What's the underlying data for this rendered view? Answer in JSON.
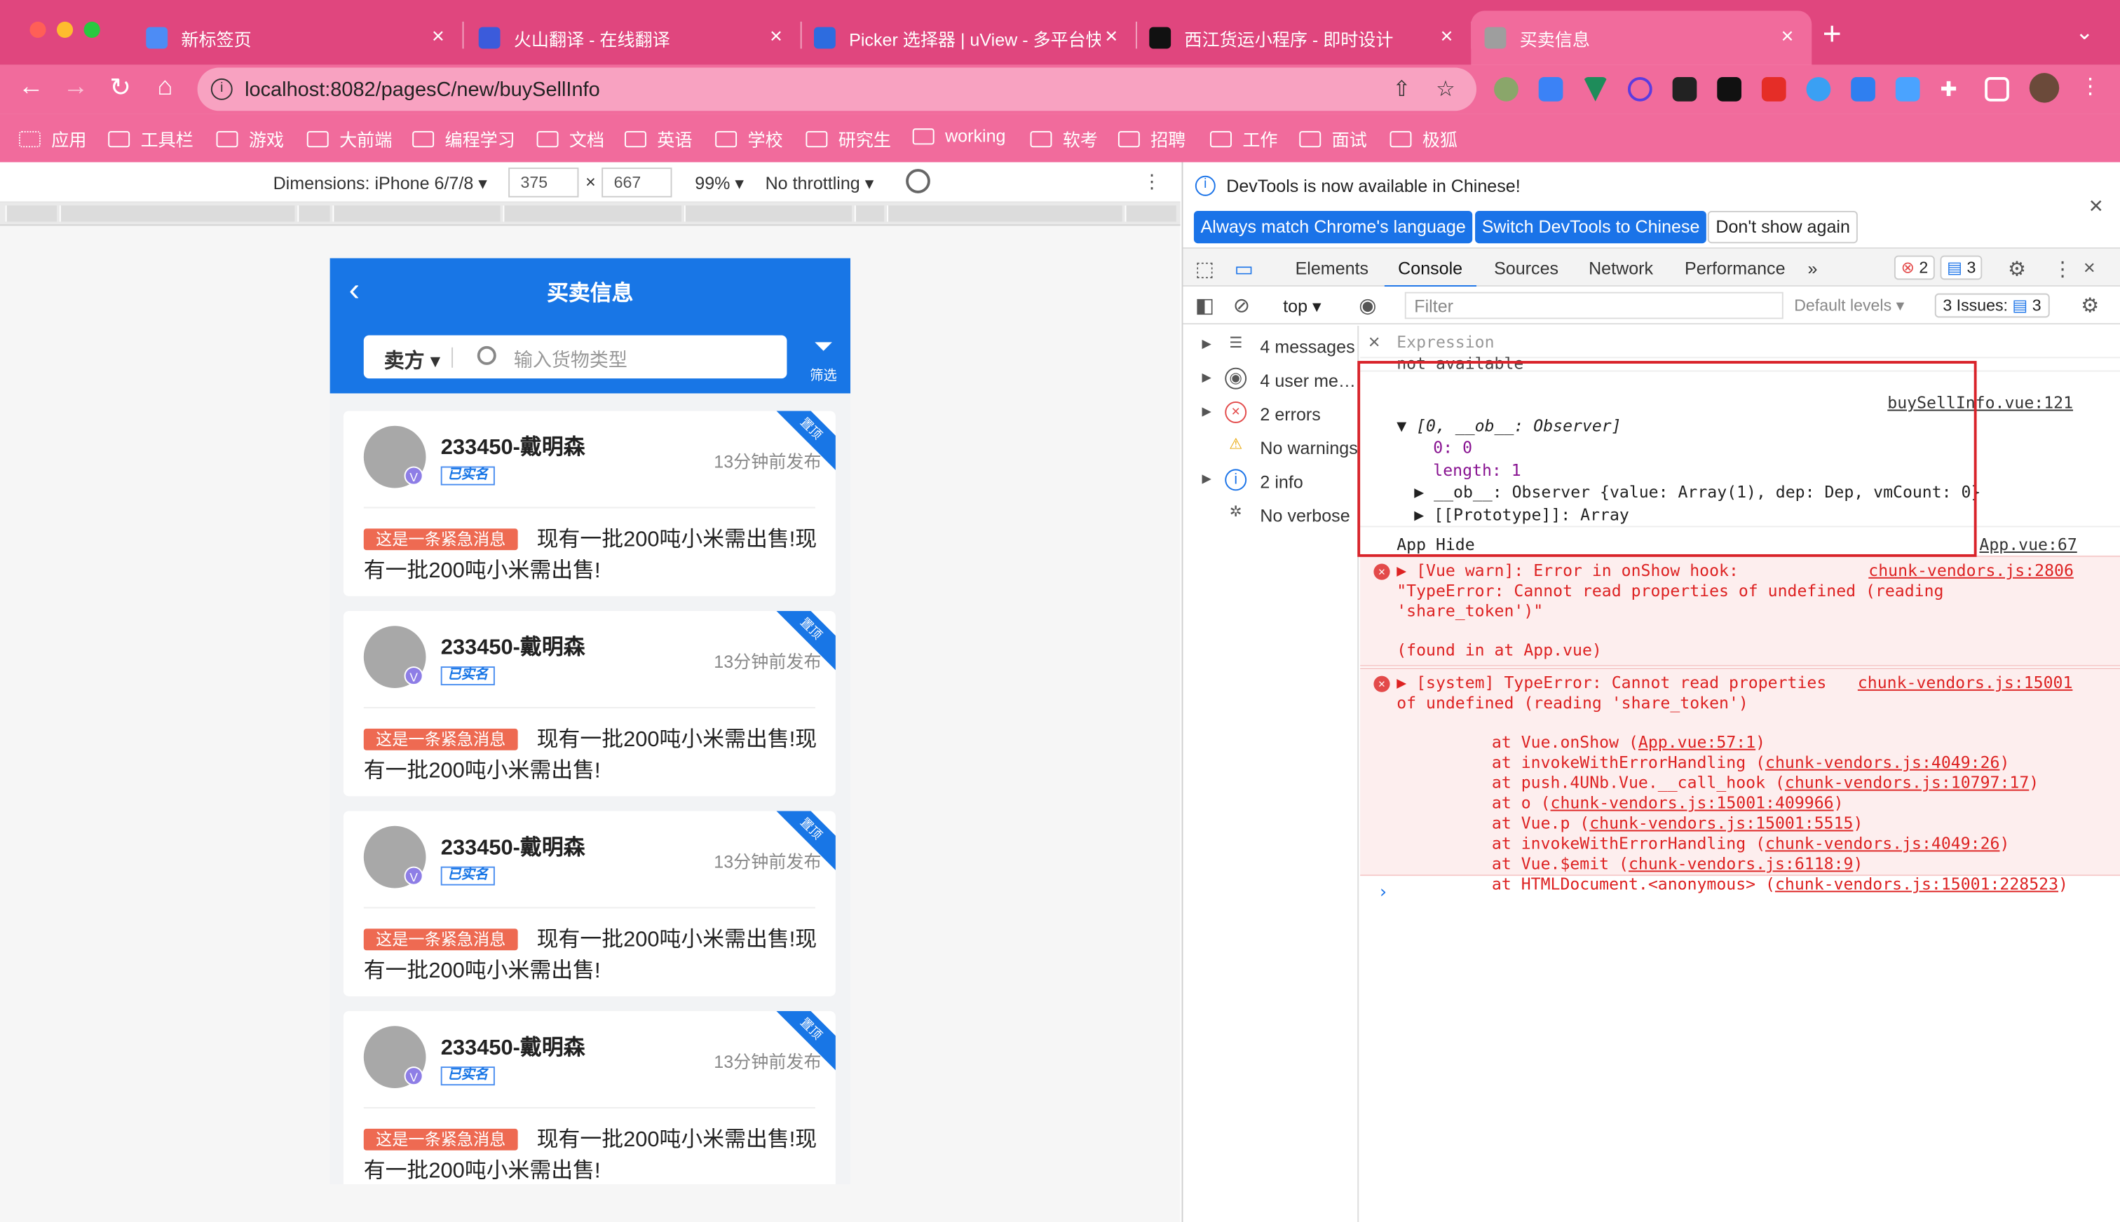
{
  "browser": {
    "tabs": [
      {
        "title": "新标签页",
        "favicon_color": "#4d8cf5"
      },
      {
        "title": "火山翻译 - 在线翻译",
        "favicon_color": "#3b5bdb"
      },
      {
        "title": "Picker 选择器 | uView - 多平台快",
        "favicon_color": "#2d6cdf"
      },
      {
        "title": "西江货运小程序 - 即时设计",
        "favicon_color": "#111111"
      },
      {
        "title": "买卖信息",
        "favicon_color": "#9e9e9e"
      }
    ],
    "url": "localhost:8082/pagesC/new/buySellInfo",
    "bookmarks": [
      "应用",
      "工具栏",
      "游戏",
      "大前端",
      "编程学习",
      "文档",
      "英语",
      "学校",
      "研究生",
      "working",
      "软考",
      "招聘",
      "工作",
      "面试",
      "极狐"
    ]
  },
  "emulator": {
    "dimensions_label": "Dimensions: iPhone 6/7/8 ▾",
    "width": "375",
    "height": "667",
    "times": "×",
    "zoom": "99% ▾",
    "throttling": "No throttling ▾"
  },
  "app": {
    "title": "买卖信息",
    "selector": "卖方 ▾",
    "search_placeholder": "输入货物类型",
    "filter_label": "筛选",
    "accent_color": "#1876e6",
    "cards": [
      {
        "name": "233450-戴明森",
        "verified": "已实名",
        "time": "13分钟前发布",
        "urgent": "这是一条紧急消息",
        "message": "现有一批200吨小米需出售!现有一批200吨小米需出售!",
        "ribbon": "置顶"
      },
      {
        "name": "233450-戴明森",
        "verified": "已实名",
        "time": "13分钟前发布",
        "urgent": "这是一条紧急消息",
        "message": "现有一批200吨小米需出售!现有一批200吨小米需出售!",
        "ribbon": "置顶"
      },
      {
        "name": "233450-戴明森",
        "verified": "已实名",
        "time": "13分钟前发布",
        "urgent": "这是一条紧急消息",
        "message": "现有一批200吨小米需出售!现有一批200吨小米需出售!",
        "ribbon": "置顶"
      },
      {
        "name": "233450-戴明森",
        "verified": "已实名",
        "time": "13分钟前发布",
        "urgent": "这是一条紧急消息",
        "message": "现有一批200吨小米需出售!现有一批200吨小米需出售!",
        "ribbon": "置顶"
      }
    ]
  },
  "devtools": {
    "banner_text": "DevTools is now available in Chinese!",
    "btn_match": "Always match Chrome's language",
    "btn_switch": "Switch DevTools to Chinese",
    "btn_dont": "Don't show again",
    "tabs": [
      "Elements",
      "Console",
      "Sources",
      "Network",
      "Performance",
      "»"
    ],
    "error_count": "2",
    "message_count": "3",
    "context": "top ▾",
    "filter_placeholder": "Filter",
    "levels": "Default levels ▾",
    "issues": "3 Issues:",
    "issues_count": "3",
    "sidebar": [
      {
        "label": "4 messages",
        "icon": "list-icon"
      },
      {
        "label": "4 user me…",
        "icon": "user-icon"
      },
      {
        "label": "2 errors",
        "icon": "error-icon"
      },
      {
        "label": "No warnings",
        "icon": "warning-icon"
      },
      {
        "label": "2 info",
        "icon": "info-icon"
      },
      {
        "label": "No verbose",
        "icon": "bug-icon"
      }
    ],
    "expression_label": "Expression",
    "console": {
      "not_available": "not available",
      "src1": "buySellInfo.vue:121",
      "array_head": "▼ [0, __ob__: Observer]",
      "prop0": "0: 0",
      "prop_len": "length: 1",
      "prop_ob": "▶ __ob__: Observer {value: Array(1), dep: Dep, vmCount: 0}",
      "prop_proto": "▶ [[Prototype]]: Array",
      "app_hide": "App Hide",
      "src2": "App.vue:67",
      "warn_line1": "▶ [Vue warn]: Error in onShow hook:",
      "warn_line2": "\"TypeError: Cannot read properties of undefined (reading",
      "warn_line3": "'share_token')\"",
      "warn_line4": "(found in at App.vue)",
      "warn_src": "chunk-vendors.js:2806",
      "err_line1": "▶ [system] TypeError: Cannot read properties",
      "err_line2": "of undefined (reading 'share_token')",
      "err_src": "chunk-vendors.js:15001",
      "stack": [
        {
          "pre": "at Vue.onShow (",
          "link": "App.vue:57:1",
          "post": ")"
        },
        {
          "pre": "at invokeWithErrorHandling (",
          "link": "chunk-vendors.js:4049:26",
          "post": ")"
        },
        {
          "pre": "at push.4UNb.Vue.__call_hook (",
          "link": "chunk-vendors.js:10797:17",
          "post": ")"
        },
        {
          "pre": "at o (",
          "link": "chunk-vendors.js:15001:409966",
          "post": ")"
        },
        {
          "pre": "at Vue.p (",
          "link": "chunk-vendors.js:15001:5515",
          "post": ")"
        },
        {
          "pre": "at invokeWithErrorHandling (",
          "link": "chunk-vendors.js:4049:26",
          "post": ")"
        },
        {
          "pre": "at Vue.$emit (",
          "link": "chunk-vendors.js:6118:9",
          "post": ")"
        },
        {
          "pre": "at HTMLDocument.<anonymous> (",
          "link": "chunk-vendors.js:15001:228523",
          "post": ")"
        }
      ],
      "prompt": "›"
    }
  }
}
